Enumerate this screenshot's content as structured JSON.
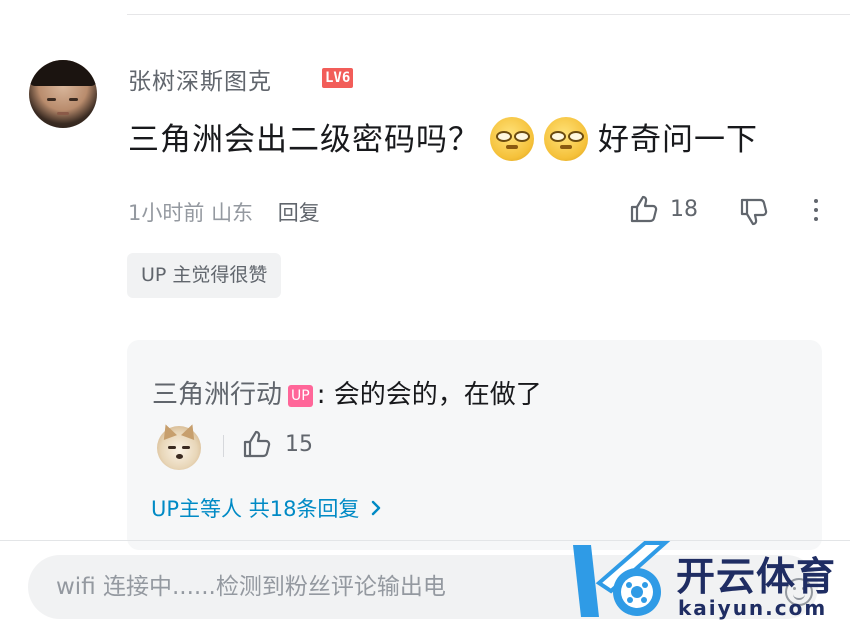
{
  "comment": {
    "username": "张树深斯图克",
    "level": "LV6",
    "text_part1": "三角洲会出二级密码吗？",
    "text_part2": "好奇问一下",
    "time": "1小时前",
    "location": "山东",
    "reply_label": "回复",
    "like_count": "18",
    "tag": "UP 主觉得很赞"
  },
  "reply": {
    "author": "三角洲行动",
    "badge": "UP",
    "text": ": 会的会的，在做了",
    "like_count": "15",
    "more_text": "UP主等人 共18条回复"
  },
  "input": {
    "text": "wifi 连接中......检测到粉丝评论输出电"
  },
  "watermark": {
    "name": "开云体育",
    "domain": "kaiyun.com"
  }
}
